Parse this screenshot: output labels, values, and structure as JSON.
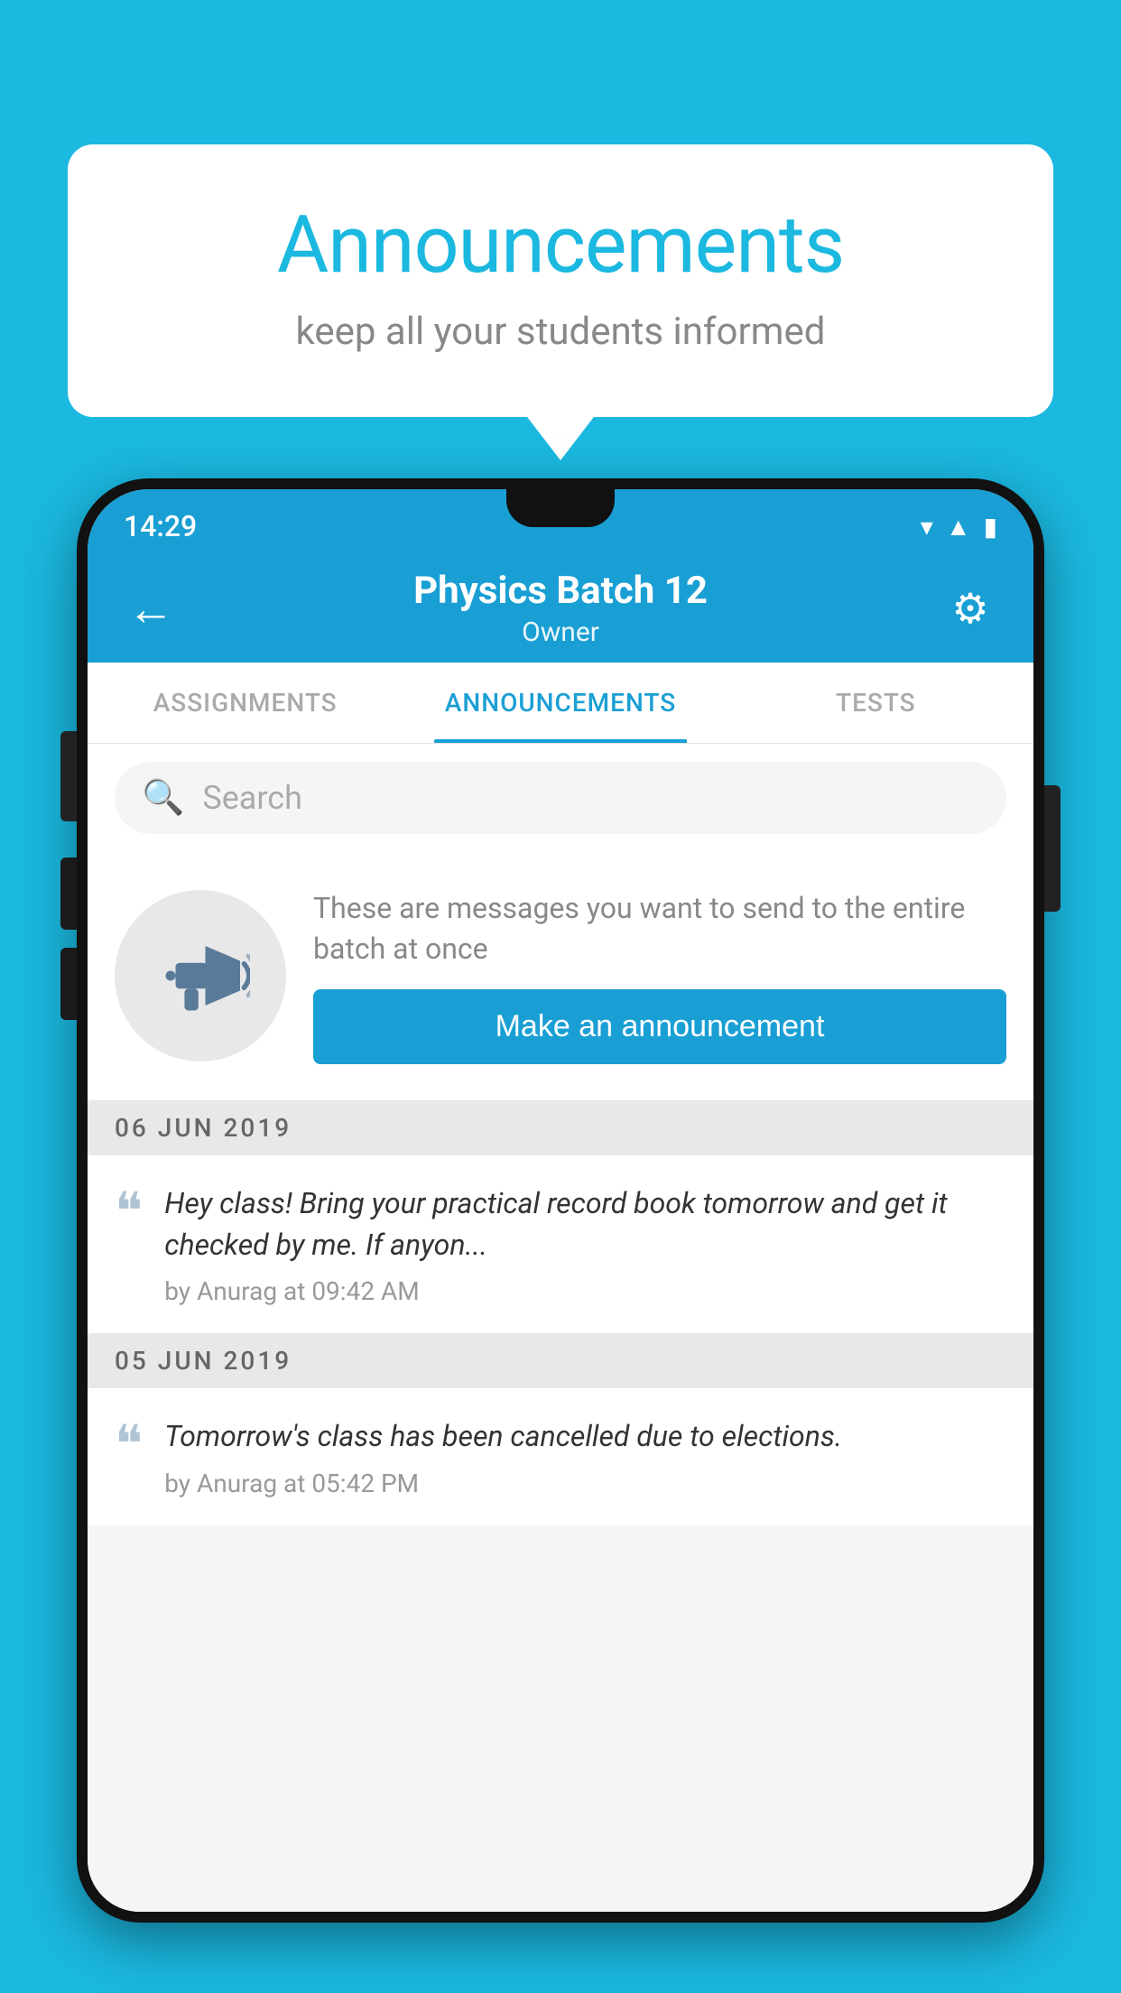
{
  "page": {
    "background_color": "#1bb8e0"
  },
  "speech_bubble": {
    "title": "Announcements",
    "subtitle": "keep all your students informed"
  },
  "phone": {
    "status_bar": {
      "time": "14:29",
      "wifi": "▾",
      "signal": "▲",
      "battery": "▮"
    },
    "app_bar": {
      "back_label": "←",
      "title": "Physics Batch 12",
      "subtitle": "Owner",
      "gear_label": "⚙"
    },
    "tabs": [
      {
        "id": "assignments",
        "label": "ASSIGNMENTS",
        "active": false
      },
      {
        "id": "announcements",
        "label": "ANNOUNCEMENTS",
        "active": true
      },
      {
        "id": "tests",
        "label": "TESTS",
        "active": false
      }
    ],
    "search": {
      "placeholder": "Search"
    },
    "promo": {
      "description_text": "These are messages you want to send to the entire batch at once",
      "button_label": "Make an announcement"
    },
    "announcements": [
      {
        "date": "06  JUN  2019",
        "message_text": "Hey class! Bring your practical record book tomorrow and get it checked by me. If anyon...",
        "message_meta": "by Anurag at 09:42 AM"
      },
      {
        "date": "05  JUN  2019",
        "message_text": "Tomorrow's class has been cancelled due to elections.",
        "message_meta": "by Anurag at 05:42 PM"
      }
    ]
  }
}
